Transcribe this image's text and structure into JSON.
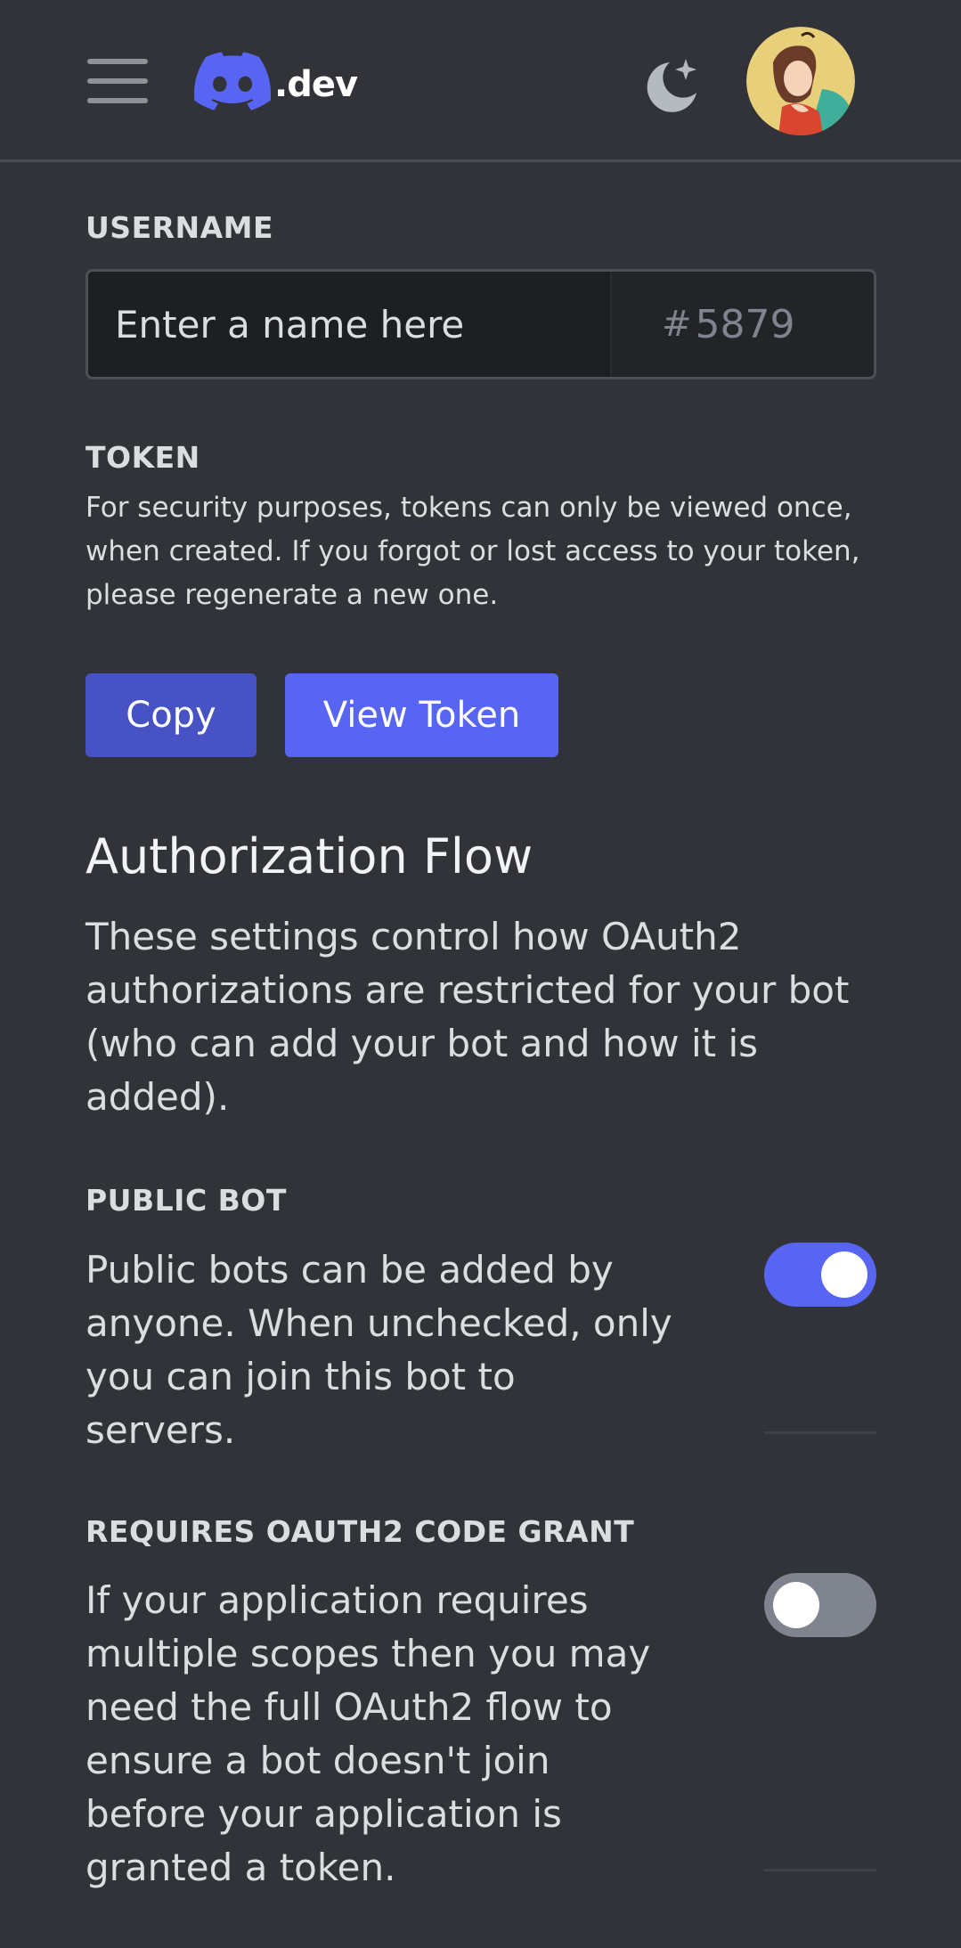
{
  "header": {
    "logo_text": ".dev",
    "menu_icon": "hamburger-menu-icon",
    "theme_icon": "moon-sparkle-icon",
    "avatar_icon": "user-avatar"
  },
  "username": {
    "label": "USERNAME",
    "placeholder": "Enter a name here",
    "discriminator_hash": "#",
    "discriminator": "5879"
  },
  "token": {
    "label": "TOKEN",
    "description": "For security purposes, tokens can only be viewed once, when created. If you forgot or lost access to your token, please regenerate a new one.",
    "copy_label": "Copy",
    "view_label": "View Token"
  },
  "authorization_flow": {
    "title": "Authorization Flow",
    "description": "These settings control how OAuth2 authorizations are restricted for your bot (who can add your bot and how it is added)."
  },
  "public_bot": {
    "label": "PUBLIC BOT",
    "description": "Public bots can be added by anyone. When unchecked, only you can join this bot to servers.",
    "enabled": true
  },
  "code_grant": {
    "label": "REQUIRES OAUTH2 CODE GRANT",
    "description": "If your application requires multiple scopes then you may need the full OAuth2 flow to ensure a bot doesn't join before your application is granted a token.",
    "enabled": false
  },
  "colors": {
    "background": "#313338",
    "accent": "#5865f2",
    "copy_button": "#4752c4",
    "toggle_off": "#80848e"
  }
}
